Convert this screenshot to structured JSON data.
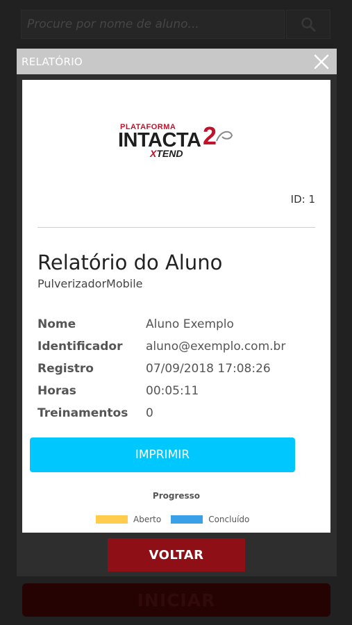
{
  "background": {
    "search_placeholder": "Procure por nome de aluno...",
    "start_label": "INICIAR"
  },
  "modal": {
    "title": "RELATÓRIO",
    "close_icon": "close-icon"
  },
  "logo": {
    "line1": "PLATAFORMA",
    "line2": "INTACTA",
    "mark": "2",
    "line3_prefix": "X",
    "line3": "TEND"
  },
  "report": {
    "id_label": "ID: 1",
    "title": "Relatório do Aluno",
    "subtitle": "PulverizadorMobile",
    "fields": [
      {
        "label": "Nome",
        "value": "Aluno Exemplo"
      },
      {
        "label": "Identificador",
        "value": "aluno@exemplo.com.br"
      },
      {
        "label": "Registro",
        "value": "07/09/2018 17:08:26"
      },
      {
        "label": "Horas",
        "value": "00:05:11"
      },
      {
        "label": "Treinamentos",
        "value": "0"
      }
    ],
    "print_label": "IMPRIMIR",
    "progress_title": "Progresso",
    "legend": [
      {
        "label": "Aberto",
        "color": "#ffcc4d"
      },
      {
        "label": "Concluído",
        "color": "#3aa0e8"
      }
    ]
  },
  "footer": {
    "back_label": "VOLTAR"
  },
  "colors": {
    "accent": "#00c8ff",
    "brand_red": "#8e0f16",
    "header_gray": "#c8c8c8"
  }
}
